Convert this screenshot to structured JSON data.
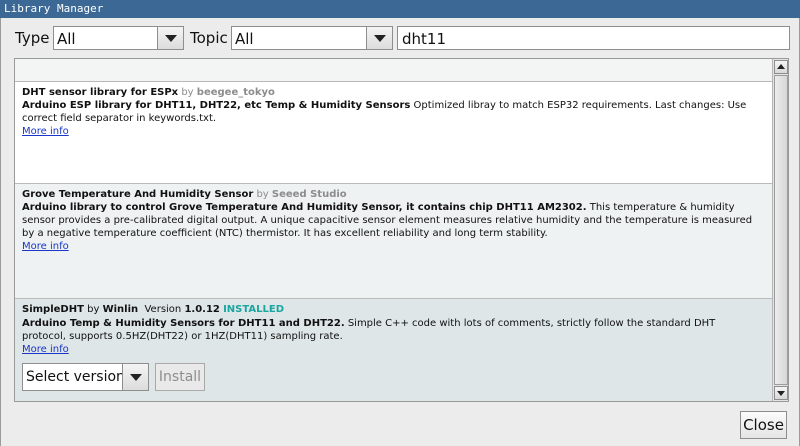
{
  "window": {
    "title": "Library Manager"
  },
  "filters": {
    "type_label": "Type",
    "type_value": "All",
    "topic_label": "Topic",
    "topic_value": "All",
    "search_value": "dht11"
  },
  "libraries": [
    {
      "name": "DHT sensor library for ESPx",
      "by_label": "by",
      "author": "beegee_tokyo",
      "summary": "Arduino ESP library for DHT11, DHT22, etc Temp & Humidity Sensors",
      "description": "Optimized libray to match ESP32 requirements. Last changes: Use correct field separator in keywords.txt.",
      "more_info": "More info"
    },
    {
      "name": "Grove Temperature And Humidity Sensor",
      "by_label": "by",
      "author": "Seeed Studio",
      "summary": "Arduino library to control Grove Temperature And Humidity Sensor, it contains chip DHT11 AM2302.",
      "description": "This temperature & humidity sensor provides a pre-calibrated digital output. A unique capacitive sensor element measures relative humidity and the temperature is measured by a negative temperature coefficient (NTC) thermistor. It has excellent reliability and long term stability.",
      "more_info": "More info"
    },
    {
      "name": "SimpleDHT",
      "by_label": "by",
      "author": "Winlin",
      "version_label": "Version",
      "version": "1.0.12",
      "status": "INSTALLED",
      "summary": "Arduino Temp & Humidity Sensors for DHT11 and DHT22.",
      "description": "Simple C++ code with lots of comments, strictly follow the standard DHT protocol, supports 0.5HZ(DHT22) or 1HZ(DHT11) sampling rate.",
      "more_info": "More info",
      "select_version": "Select version",
      "install_label": "Install"
    }
  ],
  "footer": {
    "close_label": "Close"
  },
  "colors": {
    "titlebar": "#3b6895",
    "installed": "#1aa5a0",
    "link": "#1c36c7",
    "selected_row": "#eef2f2"
  },
  "icons": [
    "dropdown-arrow-icon",
    "scroll-up-icon",
    "scroll-down-icon"
  ]
}
